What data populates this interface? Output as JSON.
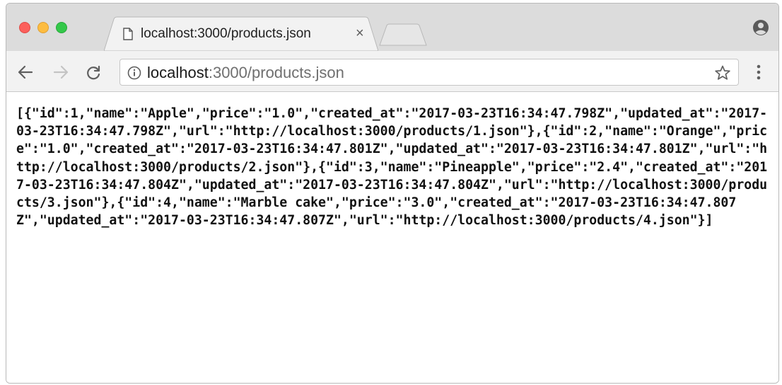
{
  "tab": {
    "title": "localhost:3000/products.json",
    "close_label": "×"
  },
  "omnibox": {
    "host": "localhost",
    "rest": ":3000/products.json"
  },
  "icons": {
    "back": "arrow-left-icon",
    "forward": "arrow-right-icon",
    "reload": "reload-icon",
    "info": "info-icon",
    "star": "star-icon",
    "menu": "kebab-menu-icon",
    "profile": "profile-icon",
    "page": "page-icon"
  },
  "colors": {
    "close": "#fc605c",
    "minimize": "#fdbc40",
    "maximize": "#34c84a"
  },
  "content": {
    "json_text": "[{\"id\":1,\"name\":\"Apple\",\"price\":\"1.0\",\"created_at\":\"2017-03-23T16:34:47.798Z\",\"updated_at\":\"2017-03-23T16:34:47.798Z\",\"url\":\"http://localhost:3000/products/1.json\"},{\"id\":2,\"name\":\"Orange\",\"price\":\"1.0\",\"created_at\":\"2017-03-23T16:34:47.801Z\",\"updated_at\":\"2017-03-23T16:34:47.801Z\",\"url\":\"http://localhost:3000/products/2.json\"},{\"id\":3,\"name\":\"Pineapple\",\"price\":\"2.4\",\"created_at\":\"2017-03-23T16:34:47.804Z\",\"updated_at\":\"2017-03-23T16:34:47.804Z\",\"url\":\"http://localhost:3000/products/3.json\"},{\"id\":4,\"name\":\"Marble cake\",\"price\":\"3.0\",\"created_at\":\"2017-03-23T16:34:47.807Z\",\"updated_at\":\"2017-03-23T16:34:47.807Z\",\"url\":\"http://localhost:3000/products/4.json\"}]"
  }
}
